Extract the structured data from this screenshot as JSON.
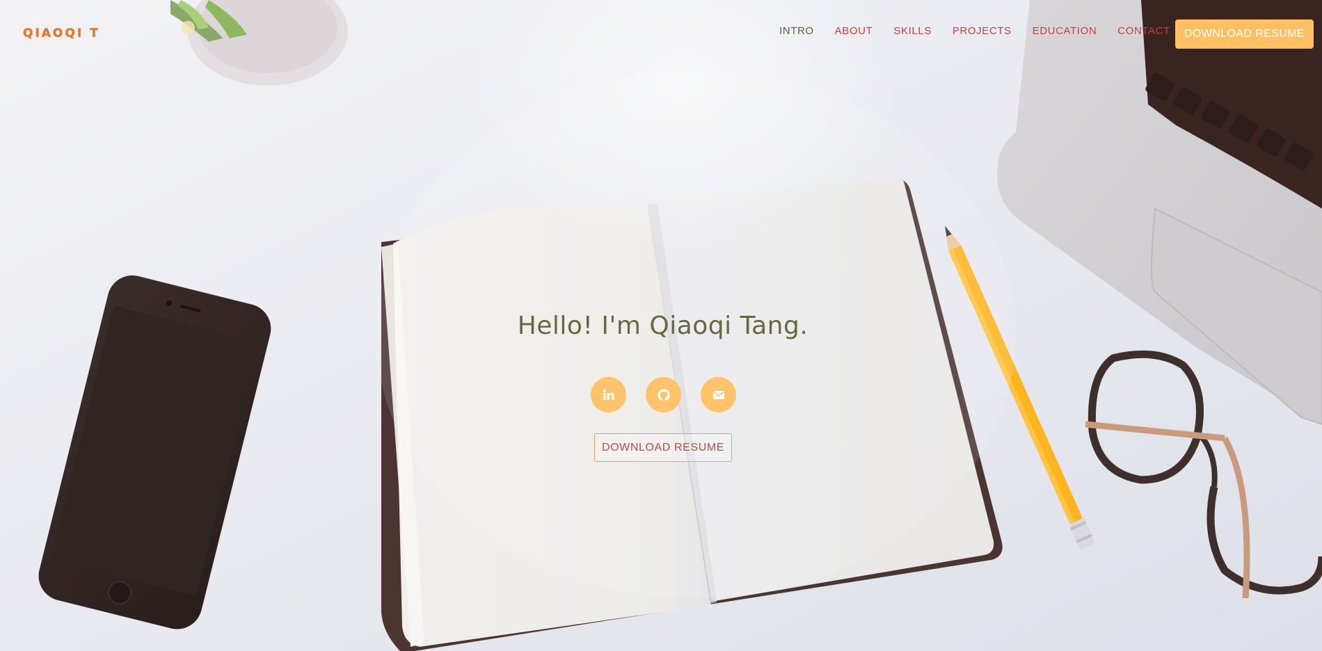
{
  "brand": {
    "logo": "QIAOQI T"
  },
  "nav": {
    "items": [
      {
        "label": "INTRO",
        "active": true
      },
      {
        "label": "ABOUT",
        "active": false
      },
      {
        "label": "SKILLS",
        "active": false
      },
      {
        "label": "PROJECTS",
        "active": false
      },
      {
        "label": "EDUCATION",
        "active": false
      },
      {
        "label": "CONTACT",
        "active": false
      }
    ],
    "download_label": "DOWNLOAD RESUME"
  },
  "hero": {
    "headline": "Hello! I'm Qiaoqi Tang.",
    "social": [
      {
        "icon": "linkedin-icon"
      },
      {
        "icon": "github-icon"
      },
      {
        "icon": "email-icon"
      }
    ],
    "download_label": "DOWNLOAD RESUME"
  },
  "colors": {
    "accent": "#ffc062",
    "nav_text": "#c24141",
    "nav_active": "#5c5e3a",
    "headline": "#66683f",
    "logo": "#e07a2a"
  }
}
